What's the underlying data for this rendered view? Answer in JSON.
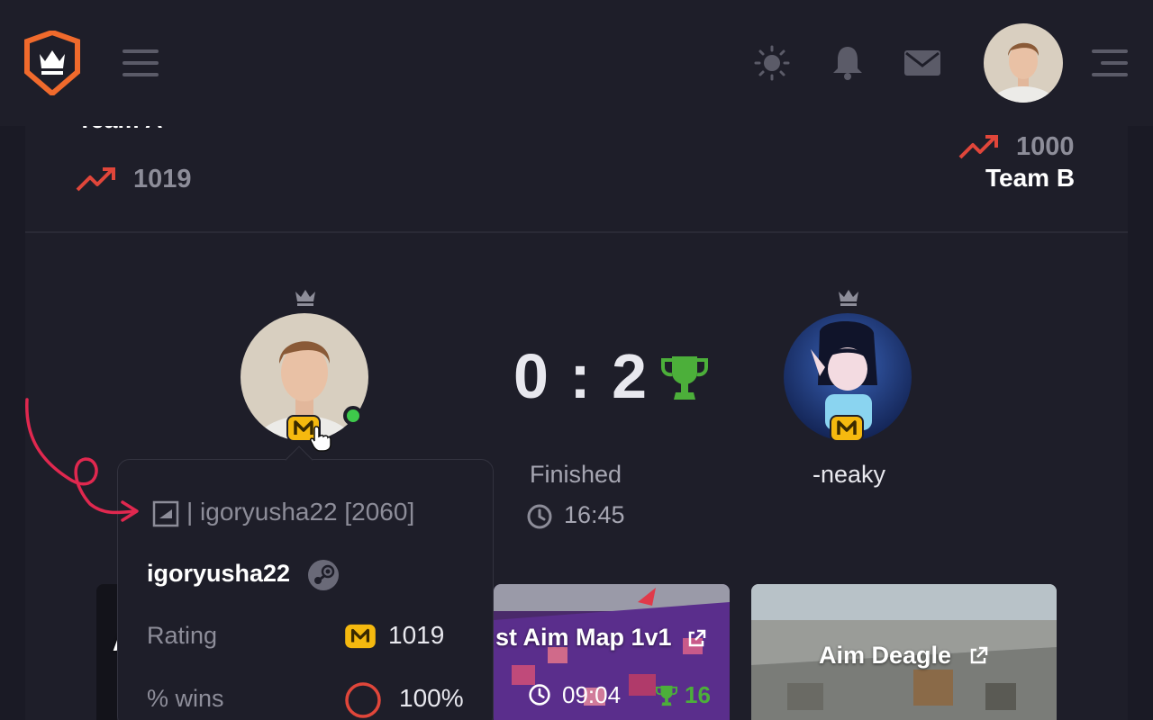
{
  "colors": {
    "background": "#1a1a25",
    "panel": "#1e1e29",
    "accent_orange": "#f06a2c",
    "trend_red": "#e0463a",
    "trophy_green": "#4caf3a",
    "badge_yellow": "#f5b90f",
    "online_green": "#3ec94b",
    "annotation_pink": "#e0284f"
  },
  "topbar": {
    "icons": [
      "crown-shield-logo",
      "hamburger-menu-icon",
      "sun-icon",
      "bell-icon",
      "mail-icon",
      "user-avatar",
      "menu-right-icon"
    ]
  },
  "match": {
    "team_a": {
      "name": "Team A",
      "rating": "1019"
    },
    "team_b": {
      "name": "Team B",
      "rating": "1000"
    },
    "score": "0 : 2",
    "status": "Finished",
    "time": "16:45",
    "player_a": {
      "badge": "M",
      "online": true
    },
    "player_b": {
      "name": "-neaky",
      "badge": "M"
    }
  },
  "popup": {
    "tag_line": "| igoryusha22 [2060]",
    "username": "igoryusha22",
    "rating_label": "Rating",
    "rating_badge": "M",
    "rating_value": "1019",
    "wins_label": "% wins",
    "wins_value": "100%"
  },
  "maps": [
    {
      "title": "A",
      "partial": true
    },
    {
      "title": "st Aim Map 1v1",
      "duration": "09:04",
      "trophies": "16"
    },
    {
      "title": "Aim Deagle"
    }
  ]
}
